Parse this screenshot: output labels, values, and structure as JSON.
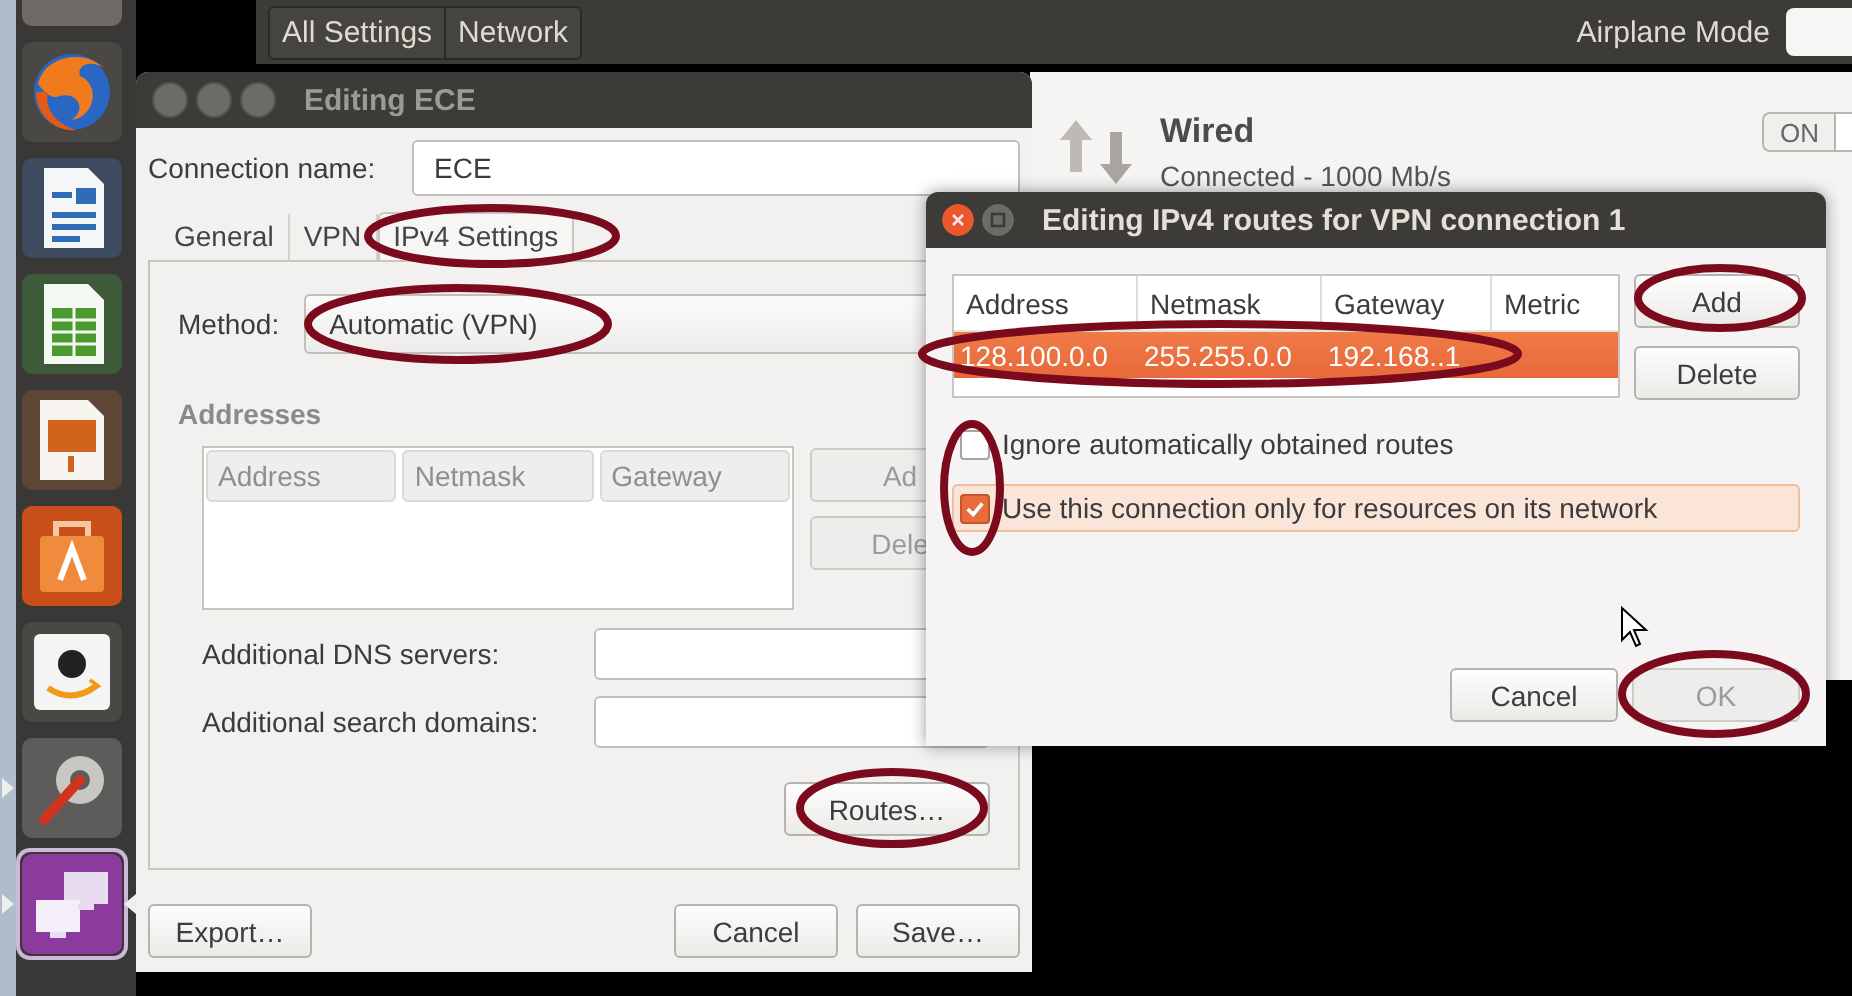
{
  "launcher": {
    "items": [
      {
        "kind": "files",
        "selected": false,
        "running": false
      },
      {
        "kind": "browser",
        "selected": false,
        "running": false
      },
      {
        "kind": "writer",
        "selected": false,
        "running": false
      },
      {
        "kind": "calc",
        "selected": false,
        "running": false
      },
      {
        "kind": "impress",
        "selected": false,
        "running": false
      },
      {
        "kind": "store",
        "selected": false,
        "running": false
      },
      {
        "kind": "shop",
        "selected": false,
        "running": false
      },
      {
        "kind": "settings",
        "selected": false,
        "running": true
      },
      {
        "kind": "remote",
        "selected": true,
        "running": true
      }
    ]
  },
  "settings_window": {
    "breadcrumbs": [
      {
        "label": "All Settings"
      },
      {
        "label": "Network"
      }
    ],
    "airplane_mode": {
      "label": "Airplane Mode",
      "on": false
    },
    "wired": {
      "title": "Wired",
      "status": "Connected - 1000 Mb/s",
      "switch": {
        "label": "ON",
        "on": true
      }
    }
  },
  "connection_editor": {
    "title": "Editing ECE",
    "connection_name": {
      "label": "Connection name:",
      "value": "ECE"
    },
    "tabs": [
      {
        "label": "General",
        "selected": false
      },
      {
        "label": "VPN",
        "selected": false
      },
      {
        "label": "IPv4 Settings",
        "selected": true
      }
    ],
    "method": {
      "label": "Method:",
      "value": "Automatic (VPN)"
    },
    "addresses": {
      "title": "Addresses",
      "disabled": true,
      "columns": [
        "Address",
        "Netmask",
        "Gateway"
      ],
      "buttons": [
        "Ad",
        "Dele"
      ]
    },
    "dns_servers": {
      "label": "Additional DNS servers:"
    },
    "search_domains": {
      "label": "Additional search domains:"
    },
    "routes_button": "Routes…",
    "buttons": [
      "Export…",
      "Cancel",
      "Save…"
    ]
  },
  "routes_dialog": {
    "title": "Editing IPv4 routes for VPN connection 1",
    "columns": [
      "Address",
      "Netmask",
      "Gateway",
      "Metric"
    ],
    "rows": [
      {
        "cells": [
          "128.100.0.0",
          "255.255.0.0",
          "192.168..1"
        ],
        "selected": true
      }
    ],
    "buttons": [
      "Add",
      "Delete"
    ],
    "options": [
      {
        "label": "Ignore automatically obtained routes",
        "checked": false,
        "highlighted": false
      },
      {
        "label": "Use this connection only for resources on its network",
        "checked": true,
        "highlighted": true
      }
    ],
    "footer_buttons": [
      {
        "label": "Cancel",
        "disabled": false
      },
      {
        "label": "OK",
        "disabled": true
      }
    ]
  }
}
